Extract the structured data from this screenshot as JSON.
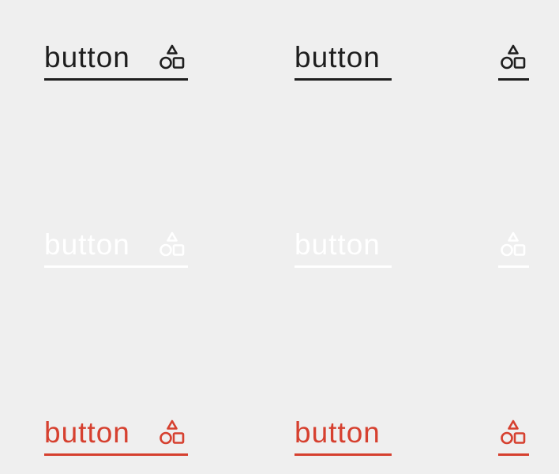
{
  "variants": {
    "dark": {
      "label": "button",
      "icon": "shapes-icon",
      "color": "#1e1e1e"
    },
    "light": {
      "label": "button",
      "icon": "shapes-icon",
      "color": "#ffffff"
    },
    "red": {
      "label": "button",
      "icon": "shapes-icon",
      "color": "#d6402f"
    }
  },
  "background": "#efefef"
}
